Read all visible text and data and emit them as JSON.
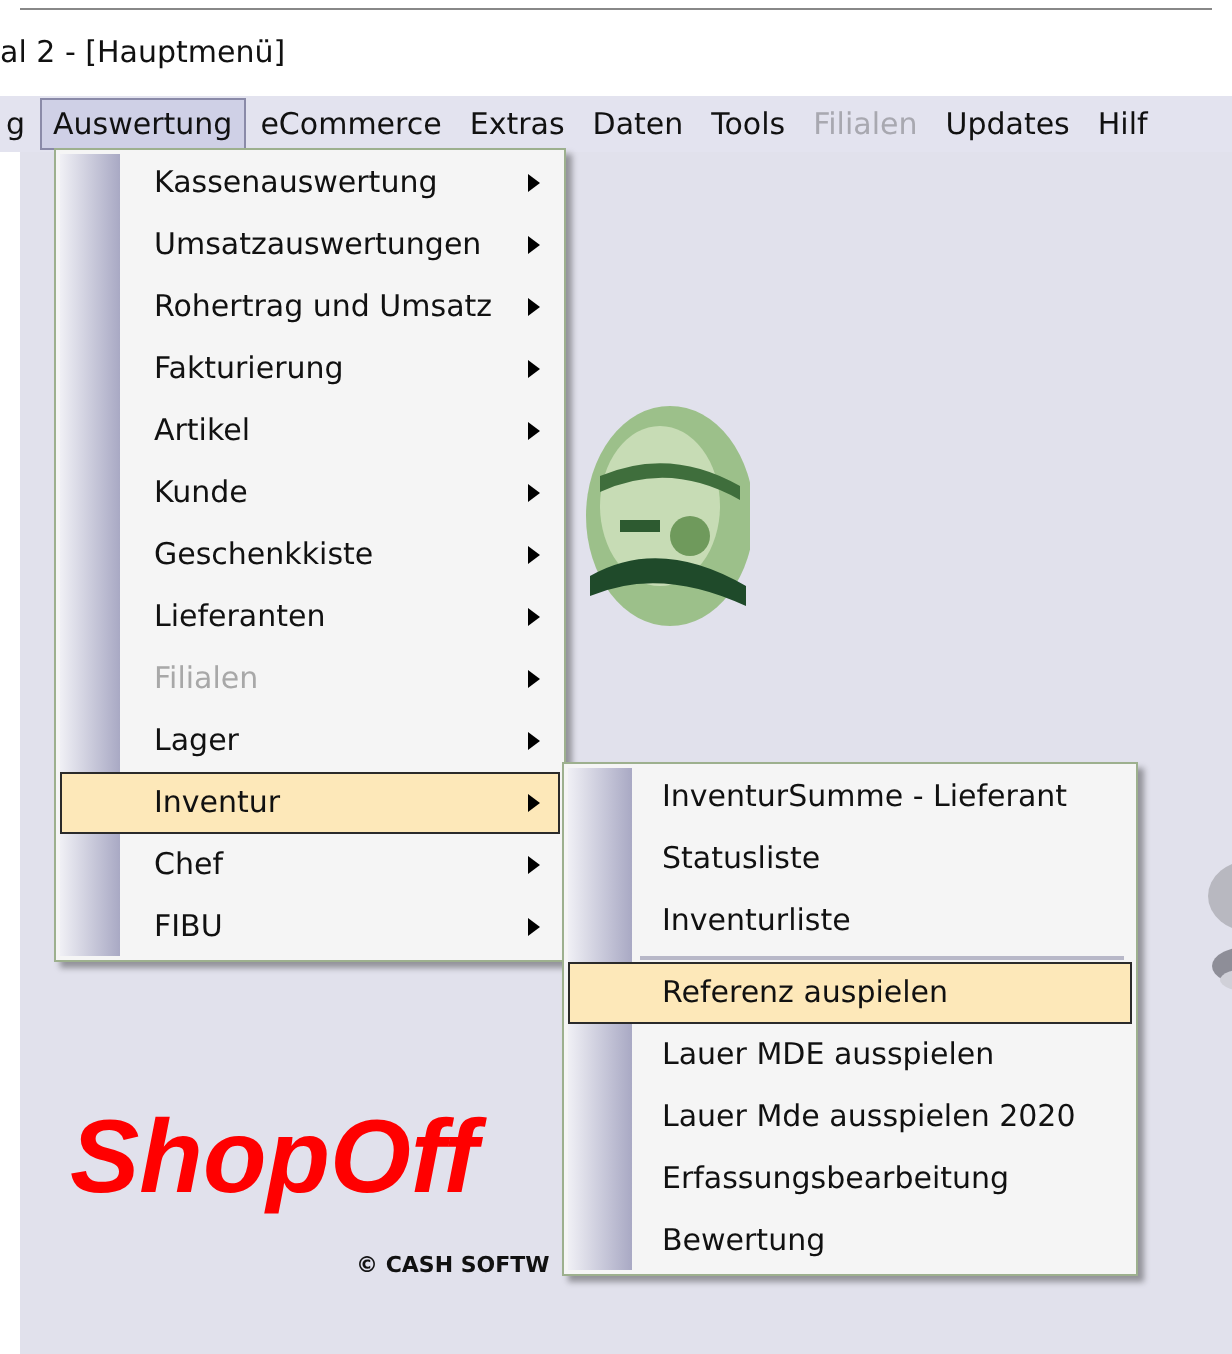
{
  "window": {
    "title": "al 2 - [Hauptmenü]"
  },
  "menu_bar": [
    {
      "label": "g",
      "selected": false,
      "disabled": false
    },
    {
      "label": "Auswertung",
      "selected": true,
      "disabled": false
    },
    {
      "label": "eCommerce",
      "selected": false,
      "disabled": false
    },
    {
      "label": "Extras",
      "selected": false,
      "disabled": false
    },
    {
      "label": "Daten",
      "selected": false,
      "disabled": false
    },
    {
      "label": "Tools",
      "selected": false,
      "disabled": false
    },
    {
      "label": "Filialen",
      "selected": false,
      "disabled": true
    },
    {
      "label": "Updates",
      "selected": false,
      "disabled": false
    },
    {
      "label": "Hilf",
      "selected": false,
      "disabled": false
    }
  ],
  "dropdown": {
    "items": [
      {
        "label": "Kassenauswertung",
        "selected": false,
        "disabled": false,
        "submenu": true
      },
      {
        "label": "Umsatzauswertungen",
        "selected": false,
        "disabled": false,
        "submenu": true
      },
      {
        "label": "Rohertrag und Umsatz",
        "selected": false,
        "disabled": false,
        "submenu": true
      },
      {
        "label": "Fakturierung",
        "selected": false,
        "disabled": false,
        "submenu": true
      },
      {
        "label": "Artikel",
        "selected": false,
        "disabled": false,
        "submenu": true
      },
      {
        "label": "Kunde",
        "selected": false,
        "disabled": false,
        "submenu": true
      },
      {
        "label": "Geschenkkiste",
        "selected": false,
        "disabled": false,
        "submenu": true
      },
      {
        "label": "Lieferanten",
        "selected": false,
        "disabled": false,
        "submenu": true
      },
      {
        "label": "Filialen",
        "selected": false,
        "disabled": true,
        "submenu": true
      },
      {
        "label": "Lager",
        "selected": false,
        "disabled": false,
        "submenu": true
      },
      {
        "label": "Inventur",
        "selected": true,
        "disabled": false,
        "submenu": true
      },
      {
        "label": "Chef",
        "selected": false,
        "disabled": false,
        "submenu": true
      },
      {
        "label": "FIBU",
        "selected": false,
        "disabled": false,
        "submenu": true
      }
    ]
  },
  "submenu": {
    "items": [
      {
        "kind": "item",
        "label": "InventurSumme - Lieferant",
        "selected": false
      },
      {
        "kind": "item",
        "label": "Statusliste",
        "selected": false
      },
      {
        "kind": "item",
        "label": "Inventurliste",
        "selected": false
      },
      {
        "kind": "separator"
      },
      {
        "kind": "item",
        "label": "Referenz auspielen",
        "selected": true
      },
      {
        "kind": "item",
        "label": "Lauer MDE ausspielen",
        "selected": false
      },
      {
        "kind": "item",
        "label": "Lauer Mde ausspielen 2020",
        "selected": false
      },
      {
        "kind": "item",
        "label": "Erfassungsbearbeitung",
        "selected": false
      },
      {
        "kind": "item",
        "label": "Bewertung",
        "selected": false
      }
    ]
  },
  "logo": {
    "text": "ShopOff"
  },
  "copyright": "© CASH SOFTW"
}
